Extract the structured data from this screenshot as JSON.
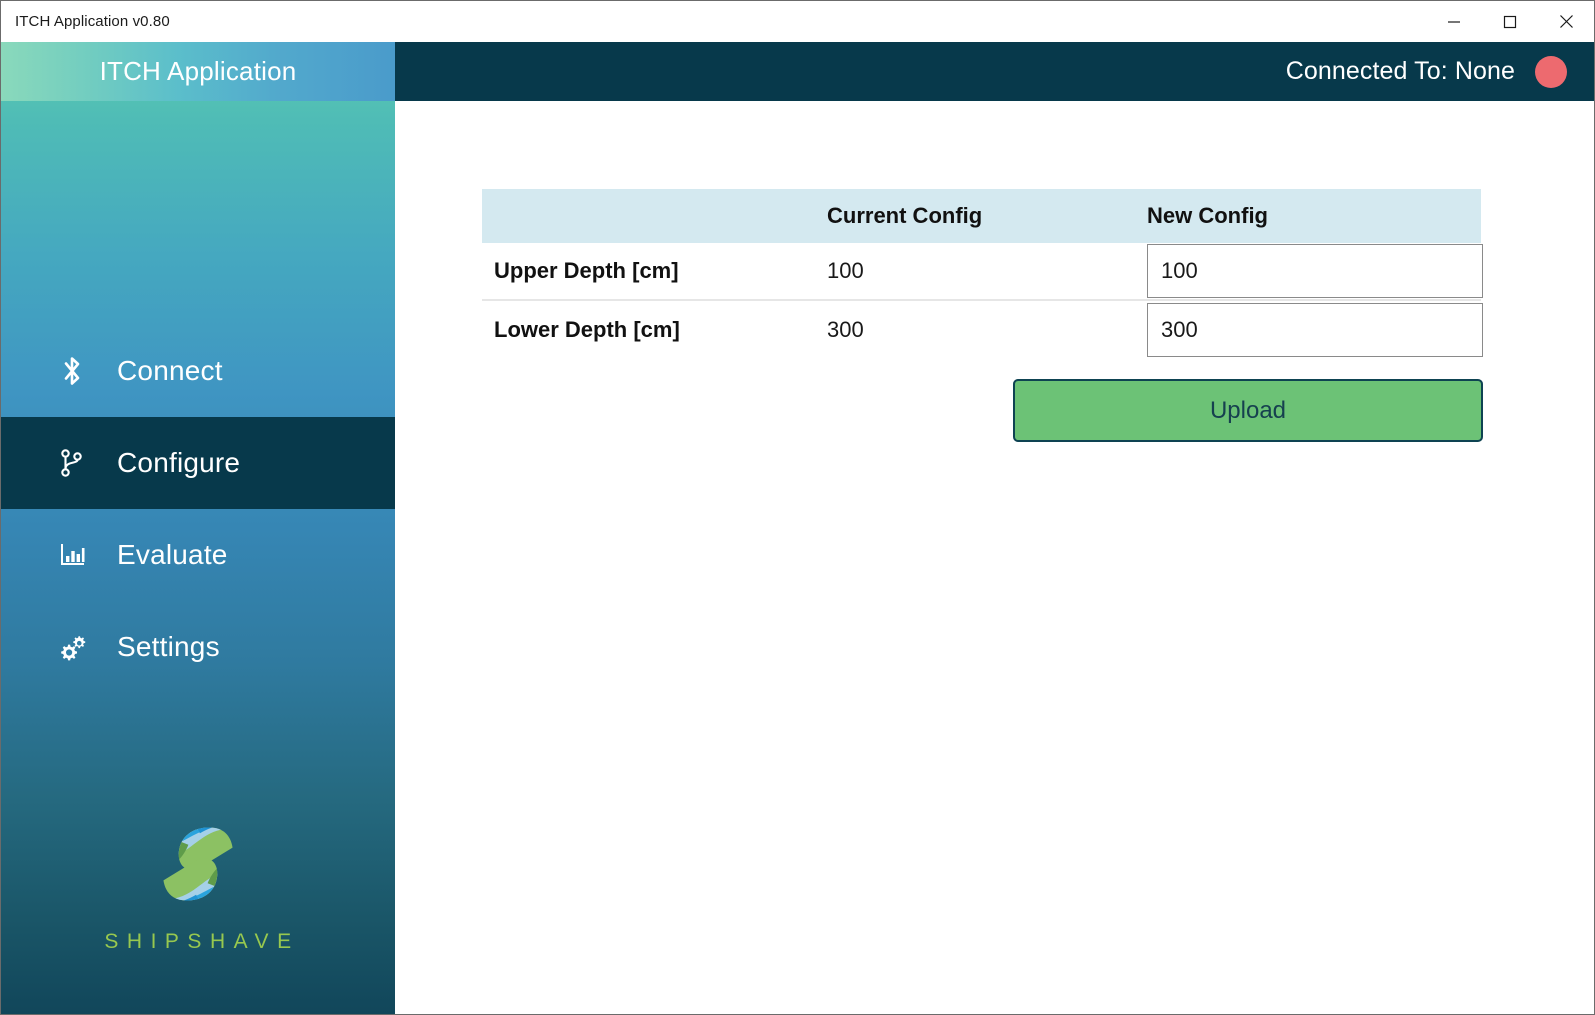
{
  "window": {
    "title": "ITCH Application v0.80",
    "controls": [
      {
        "name": "minimize",
        "glyph": "minimize-icon"
      },
      {
        "name": "maximize",
        "glyph": "maximize-icon"
      },
      {
        "name": "close",
        "glyph": "close-icon"
      }
    ]
  },
  "sidebar": {
    "header_title": "ITCH Application",
    "items": [
      {
        "label": "Connect",
        "icon": "bluetooth-icon",
        "active": false
      },
      {
        "label": "Configure",
        "icon": "branch-icon",
        "active": true
      },
      {
        "label": "Evaluate",
        "icon": "bar-chart-icon",
        "active": false
      },
      {
        "label": "Settings",
        "icon": "gears-icon",
        "active": false
      }
    ],
    "brand": {
      "name": "SHIPSHAVE",
      "logo_icon": "shipshave-globe-logo"
    }
  },
  "topbar": {
    "connection_label": "Connected To: None",
    "status_indicator": "status-dot-disconnected",
    "status_color": "#ed6a6f"
  },
  "main": {
    "table": {
      "headers": [
        "",
        "Current Config",
        "New Config"
      ],
      "rows": [
        {
          "label": "Upper Depth [cm]",
          "current": "100",
          "new_value": "100"
        },
        {
          "label": "Lower Depth [cm]",
          "current": "300",
          "new_value": "300"
        }
      ]
    },
    "upload_button": {
      "label": "Upload",
      "color": "#6cc276"
    }
  },
  "colors": {
    "header_bar": "#07394b",
    "table_header": "#d4e9f0",
    "accent_green": "#6cc276",
    "brand_green": "#97c84f"
  }
}
